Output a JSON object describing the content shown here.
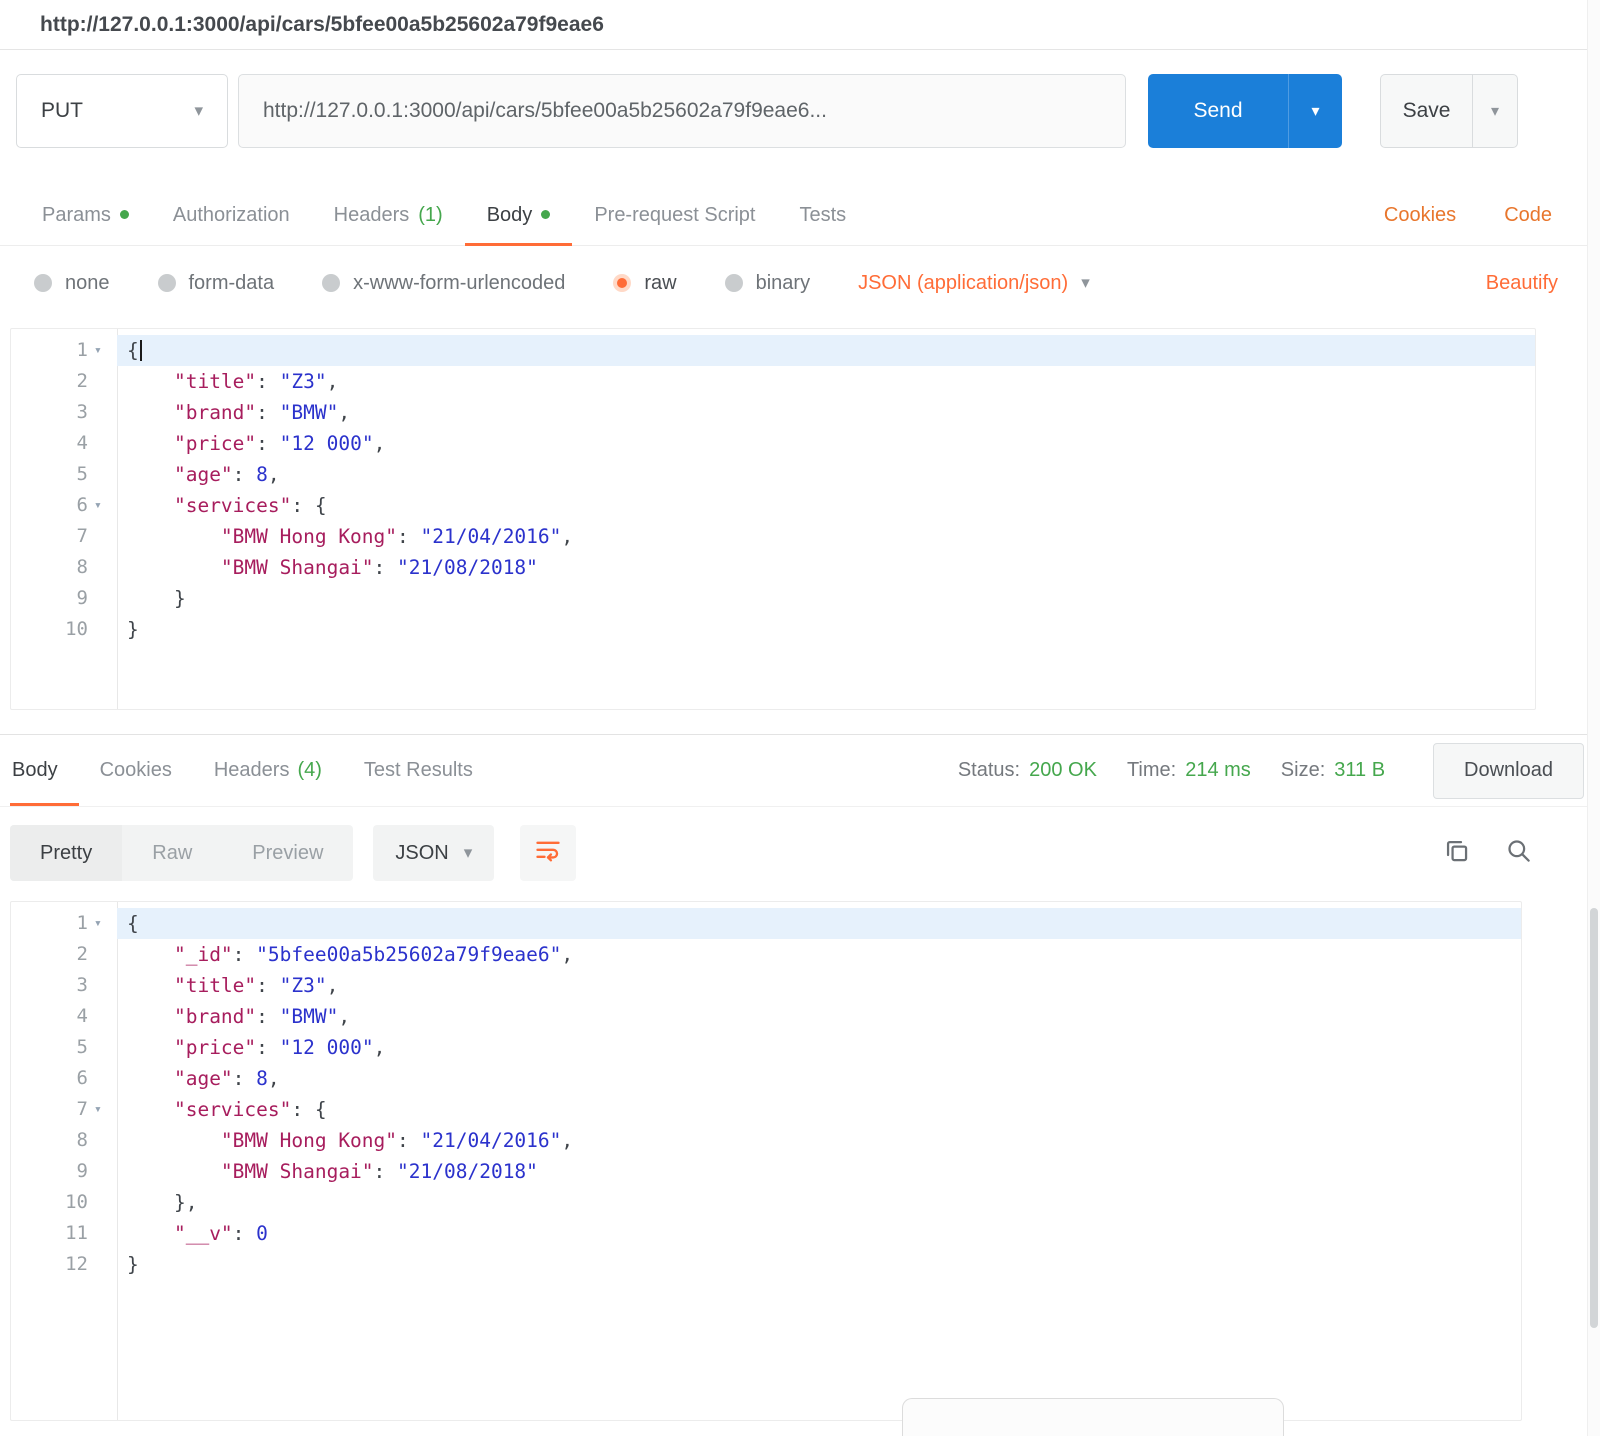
{
  "colors": {
    "accent_orange": "#ff6c37",
    "link_orange": "#e8762d",
    "success_green": "#45a74d",
    "send_button_blue": "#1b7fd9",
    "json_key": "#a71d5d",
    "json_string": "#2b32cc",
    "json_number": "#2b32cc",
    "active_line_bg": "#e6f1fc"
  },
  "header": {
    "tab_title": "http://127.0.0.1:3000/api/cars/5bfee00a5b25602a79f9eae6"
  },
  "request_bar": {
    "method": "PUT",
    "url": "http://127.0.0.1:3000/api/cars/5bfee00a5b25602a79f9eae6...",
    "send_label": "Send",
    "save_label": "Save"
  },
  "request_tabs": {
    "items": [
      {
        "label": "Params"
      },
      {
        "label": "Authorization"
      },
      {
        "label": "Headers",
        "count": "(1)"
      },
      {
        "label": "Body"
      },
      {
        "label": "Pre-request Script"
      },
      {
        "label": "Tests"
      }
    ],
    "cookies_link": "Cookies",
    "code_link": "Code"
  },
  "body_type_bar": {
    "options": [
      {
        "label": "none"
      },
      {
        "label": "form-data"
      },
      {
        "label": "x-www-form-urlencoded"
      },
      {
        "label": "raw"
      },
      {
        "label": "binary"
      }
    ],
    "content_type": "JSON (application/json)",
    "beautify_link": "Beautify"
  },
  "request_editor": {
    "lines": [
      {
        "n": "1",
        "active": true,
        "fold": true,
        "caret": true,
        "t": [
          [
            "pln",
            "{"
          ]
        ]
      },
      {
        "n": "2",
        "t": [
          [
            "ws",
            "    "
          ],
          [
            "key",
            "\"title\""
          ],
          [
            "pln",
            ": "
          ],
          [
            "str",
            "\"Z3\""
          ],
          [
            "pln",
            ","
          ]
        ]
      },
      {
        "n": "3",
        "t": [
          [
            "ws",
            "    "
          ],
          [
            "key",
            "\"brand\""
          ],
          [
            "pln",
            ": "
          ],
          [
            "str",
            "\"BMW\""
          ],
          [
            "pln",
            ","
          ]
        ]
      },
      {
        "n": "4",
        "t": [
          [
            "ws",
            "    "
          ],
          [
            "key",
            "\"price\""
          ],
          [
            "pln",
            ": "
          ],
          [
            "str",
            "\"12 000\""
          ],
          [
            "pln",
            ","
          ]
        ]
      },
      {
        "n": "5",
        "t": [
          [
            "ws",
            "    "
          ],
          [
            "key",
            "\"age\""
          ],
          [
            "pln",
            ": "
          ],
          [
            "num",
            "8"
          ],
          [
            "pln",
            ","
          ]
        ]
      },
      {
        "n": "6",
        "fold": true,
        "t": [
          [
            "ws",
            "    "
          ],
          [
            "key",
            "\"services\""
          ],
          [
            "pln",
            ": {"
          ]
        ]
      },
      {
        "n": "7",
        "t": [
          [
            "ws",
            "        "
          ],
          [
            "key",
            "\"BMW Hong Kong\""
          ],
          [
            "pln",
            ": "
          ],
          [
            "str",
            "\"21/04/2016\""
          ],
          [
            "pln",
            ","
          ]
        ]
      },
      {
        "n": "8",
        "t": [
          [
            "ws",
            "        "
          ],
          [
            "key",
            "\"BMW Shangai\""
          ],
          [
            "pln",
            ": "
          ],
          [
            "str",
            "\"21/08/2018\""
          ]
        ]
      },
      {
        "n": "9",
        "t": [
          [
            "ws",
            "    "
          ],
          [
            "pln",
            "}"
          ]
        ]
      },
      {
        "n": "10",
        "t": [
          [
            "pln",
            "}"
          ]
        ]
      }
    ]
  },
  "response": {
    "tabs": [
      {
        "label": "Body"
      },
      {
        "label": "Cookies"
      },
      {
        "label": "Headers",
        "count": "(4)"
      },
      {
        "label": "Test Results"
      }
    ],
    "status_label": "Status:",
    "status_value": "200 OK",
    "time_label": "Time:",
    "time_value": "214 ms",
    "size_label": "Size:",
    "size_value": "311 B",
    "download_label": "Download",
    "view_tabs": [
      {
        "label": "Pretty"
      },
      {
        "label": "Raw"
      },
      {
        "label": "Preview"
      }
    ],
    "format_select": "JSON"
  },
  "response_editor": {
    "lines": [
      {
        "n": "1",
        "active": true,
        "fold": true,
        "t": [
          [
            "pln",
            "{"
          ]
        ]
      },
      {
        "n": "2",
        "t": [
          [
            "ws",
            "    "
          ],
          [
            "key",
            "\"_id\""
          ],
          [
            "pln",
            ": "
          ],
          [
            "str",
            "\"5bfee00a5b25602a79f9eae6\""
          ],
          [
            "pln",
            ","
          ]
        ]
      },
      {
        "n": "3",
        "t": [
          [
            "ws",
            "    "
          ],
          [
            "key",
            "\"title\""
          ],
          [
            "pln",
            ": "
          ],
          [
            "str",
            "\"Z3\""
          ],
          [
            "pln",
            ","
          ]
        ]
      },
      {
        "n": "4",
        "t": [
          [
            "ws",
            "    "
          ],
          [
            "key",
            "\"brand\""
          ],
          [
            "pln",
            ": "
          ],
          [
            "str",
            "\"BMW\""
          ],
          [
            "pln",
            ","
          ]
        ]
      },
      {
        "n": "5",
        "t": [
          [
            "ws",
            "    "
          ],
          [
            "key",
            "\"price\""
          ],
          [
            "pln",
            ": "
          ],
          [
            "str",
            "\"12 000\""
          ],
          [
            "pln",
            ","
          ]
        ]
      },
      {
        "n": "6",
        "t": [
          [
            "ws",
            "    "
          ],
          [
            "key",
            "\"age\""
          ],
          [
            "pln",
            ": "
          ],
          [
            "num",
            "8"
          ],
          [
            "pln",
            ","
          ]
        ]
      },
      {
        "n": "7",
        "fold": true,
        "t": [
          [
            "ws",
            "    "
          ],
          [
            "key",
            "\"services\""
          ],
          [
            "pln",
            ": {"
          ]
        ]
      },
      {
        "n": "8",
        "t": [
          [
            "ws",
            "        "
          ],
          [
            "key",
            "\"BMW Hong Kong\""
          ],
          [
            "pln",
            ": "
          ],
          [
            "str",
            "\"21/04/2016\""
          ],
          [
            "pln",
            ","
          ]
        ]
      },
      {
        "n": "9",
        "t": [
          [
            "ws",
            "        "
          ],
          [
            "key",
            "\"BMW Shangai\""
          ],
          [
            "pln",
            ": "
          ],
          [
            "str",
            "\"21/08/2018\""
          ]
        ]
      },
      {
        "n": "10",
        "t": [
          [
            "ws",
            "    "
          ],
          [
            "pln",
            "},"
          ]
        ]
      },
      {
        "n": "11",
        "t": [
          [
            "ws",
            "    "
          ],
          [
            "key",
            "\"__v\""
          ],
          [
            "pln",
            ": "
          ],
          [
            "num",
            "0"
          ]
        ]
      },
      {
        "n": "12",
        "t": [
          [
            "pln",
            "}"
          ]
        ]
      }
    ]
  }
}
